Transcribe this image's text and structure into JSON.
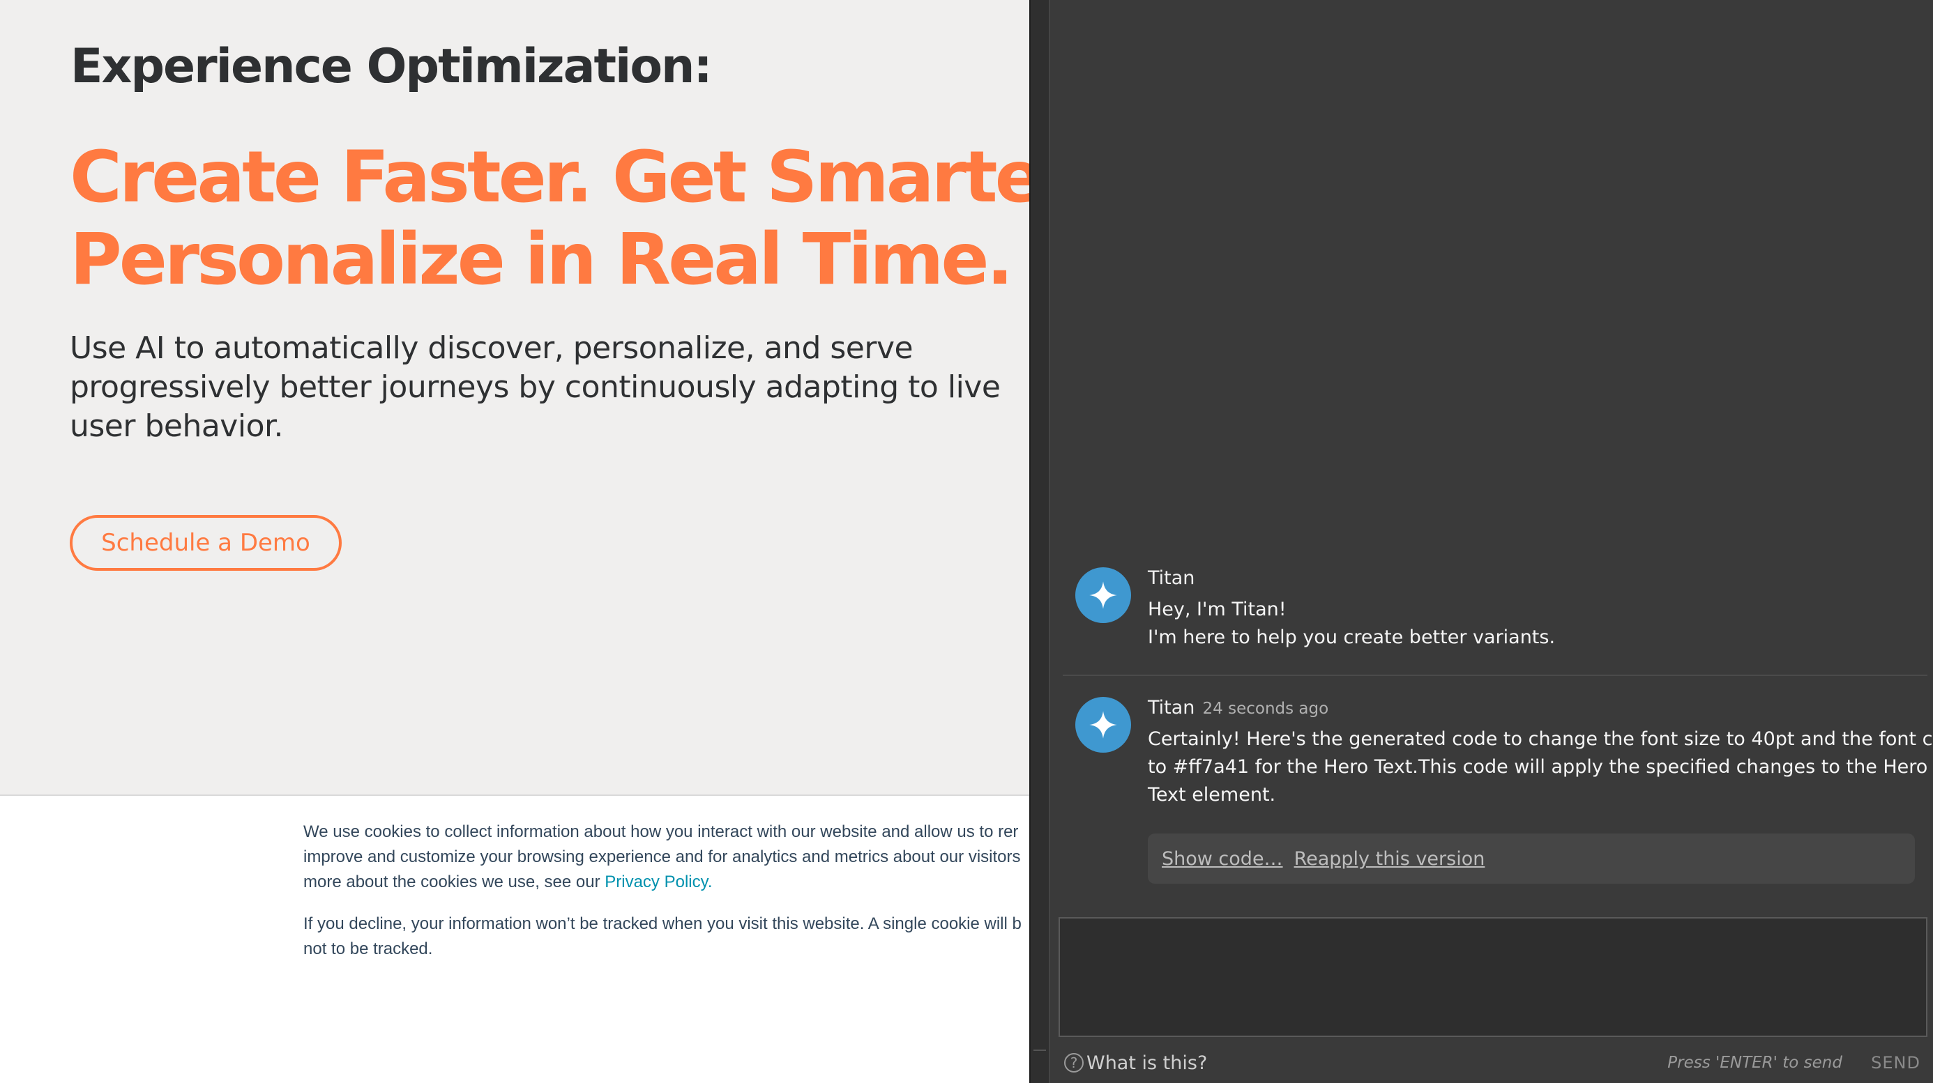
{
  "site": {
    "eyebrow": "Experience Optimization:",
    "headline_line1": "Create Faster. Get Smarter.",
    "headline_line2": "Personalize in Real Time.",
    "subtext": "Use AI to automatically discover, personalize, and serve progressively better journeys by continuously adapting to live user behavior.",
    "cta_label": "Schedule a Demo",
    "cookie": {
      "p1_line1": "We use cookies to collect information about how you interact with our website and allow us to rer",
      "p1_line2": "improve and customize your browsing experience and for analytics and metrics about our visitors",
      "p1_line3_prefix": "more about the cookies we use, see our ",
      "privacy_link": "Privacy Policy.",
      "p2_line1": "If you decline, your information won’t be tracked when you visit this website. A single cookie will b",
      "p2_line2": "not to be tracked."
    }
  },
  "chat": {
    "messages": [
      {
        "author": "Titan",
        "time": "",
        "lines": [
          "Hey, I'm Titan!",
          "I'm here to help you create better variants."
        ]
      },
      {
        "author": "Titan",
        "time": "24 seconds ago",
        "lines": [
          "Certainly! Here's the generated code to change the font size to 40pt and the font color",
          "to #ff7a41 for the Hero Text.This code will apply the specified changes to the Hero",
          "Text element."
        ]
      }
    ],
    "show_code_label": "Show code…",
    "reapply_label": "Reapply this version",
    "input_placeholder": "",
    "help_label": "What is this?",
    "hint": "Press 'ENTER' to send",
    "send_label": "SEND"
  },
  "colors": {
    "brand_orange": "#ff7a41",
    "avatar_blue": "#3f98d0",
    "panel_bg": "#3a3a3a",
    "hero_bg": "#f0efee"
  },
  "icons": {
    "avatar": "sparkle-icon",
    "help": "question-circle-icon"
  }
}
